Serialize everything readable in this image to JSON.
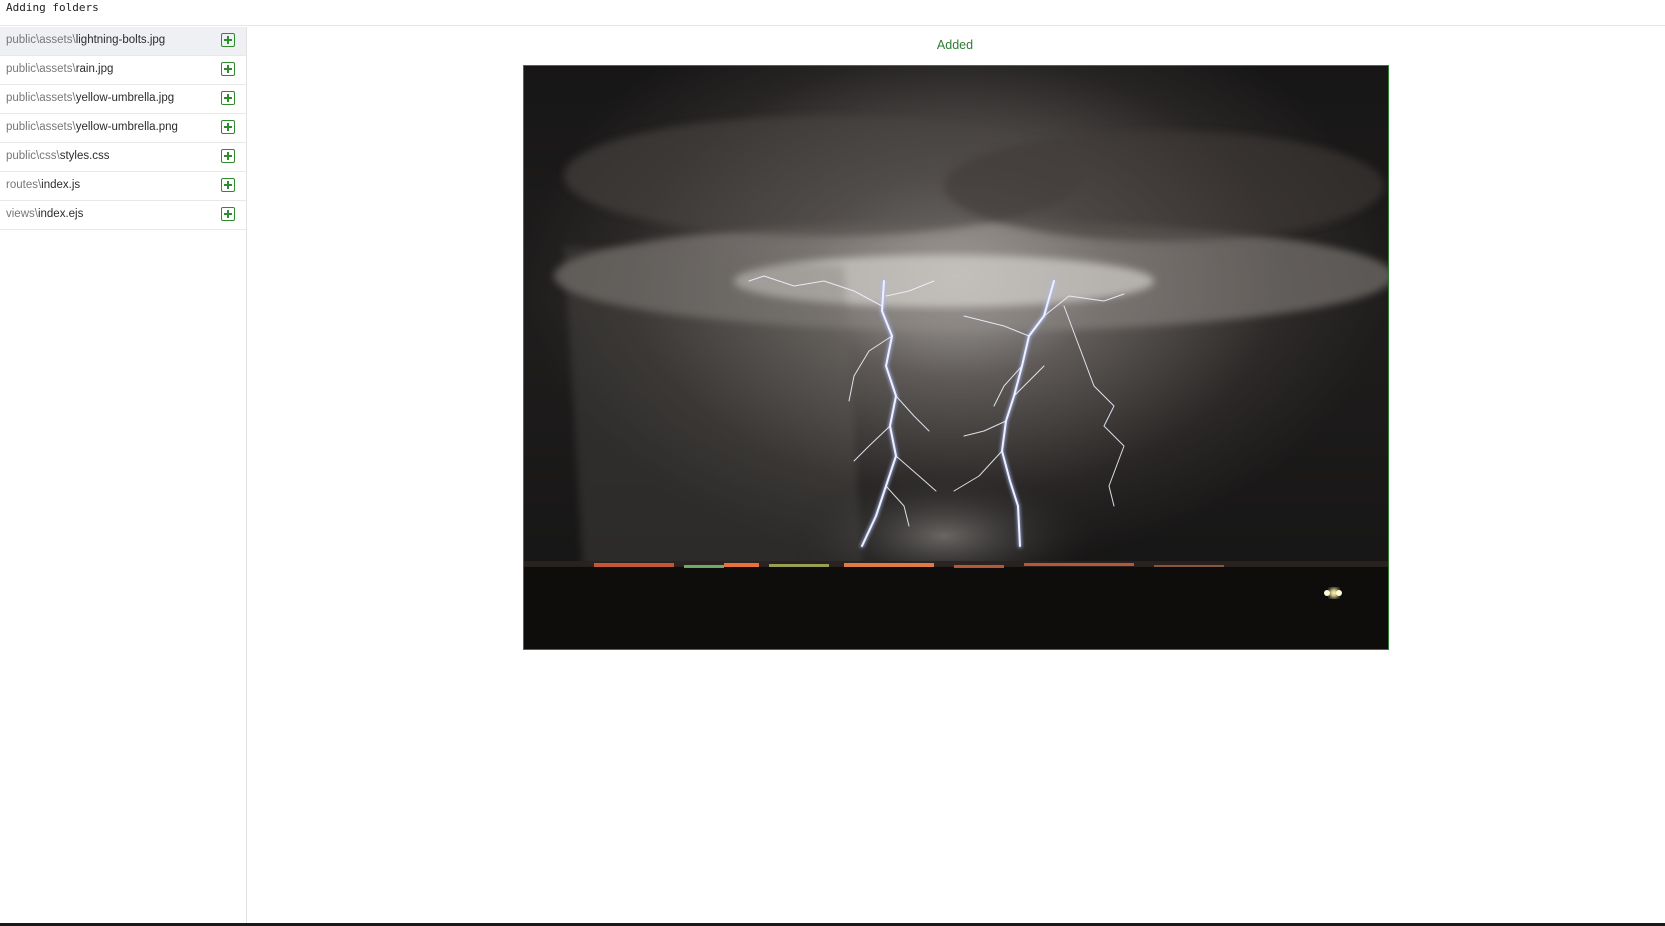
{
  "window": {
    "title": "Adding folders"
  },
  "files": [
    {
      "dir": "public\\assets\\",
      "name": "lightning-bolts.jpg",
      "selected": true
    },
    {
      "dir": "public\\assets\\",
      "name": "rain.jpg",
      "selected": false
    },
    {
      "dir": "public\\assets\\",
      "name": "yellow-umbrella.jpg",
      "selected": false
    },
    {
      "dir": "public\\assets\\",
      "name": "yellow-umbrella.png",
      "selected": false
    },
    {
      "dir": "public\\css\\",
      "name": "styles.css",
      "selected": false
    },
    {
      "dir": "routes\\",
      "name": "index.js",
      "selected": false
    },
    {
      "dir": "views\\",
      "name": "index.ejs",
      "selected": false
    }
  ],
  "file_icon": "plus-square-icon",
  "preview": {
    "status": "Added",
    "image_subject": "lightning-bolts"
  },
  "colors": {
    "accent_green": "#2e7d32",
    "selected_row": "#eef0f3"
  }
}
